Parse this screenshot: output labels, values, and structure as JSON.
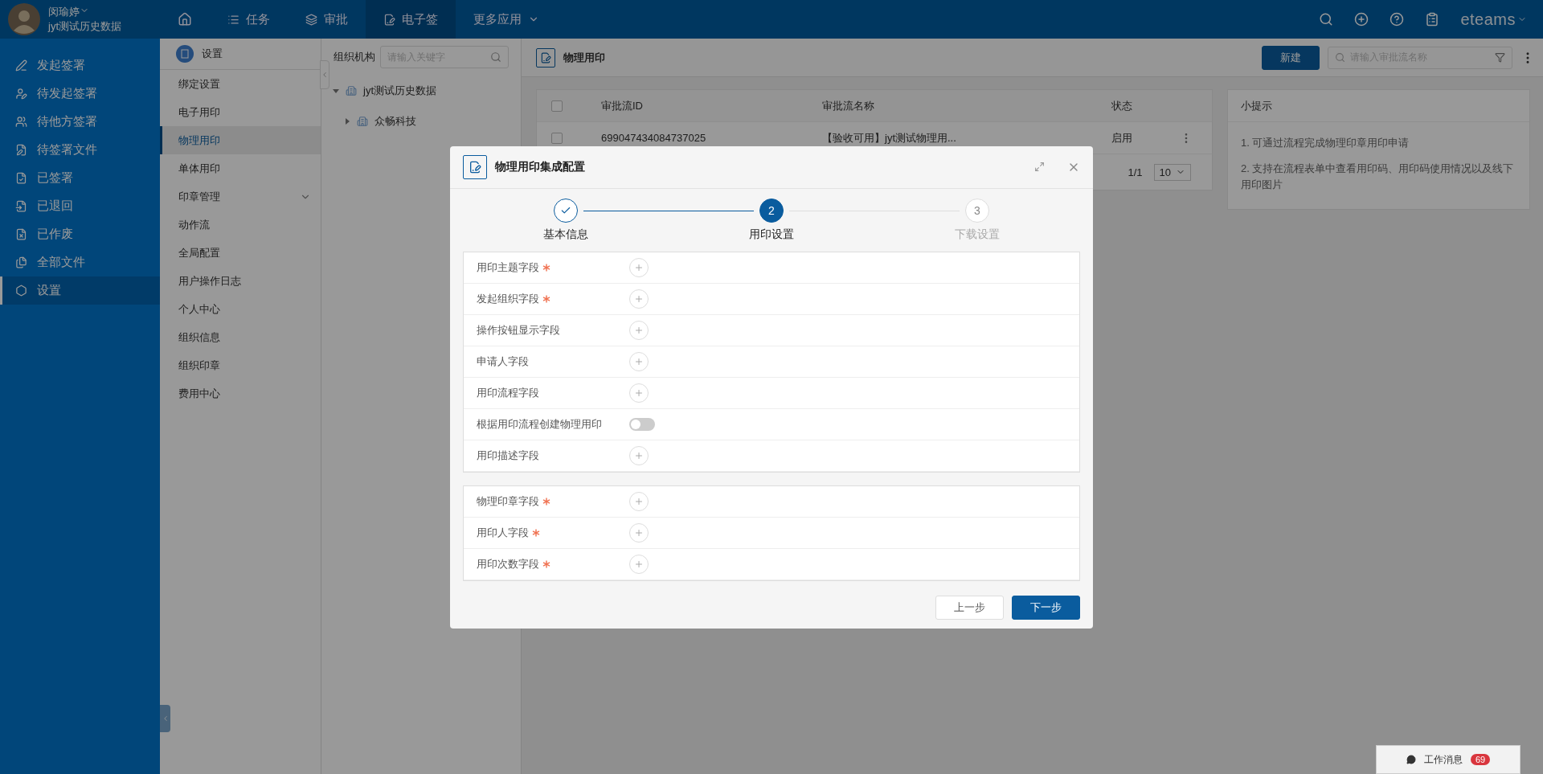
{
  "top_bar": {
    "user": {
      "name": "闵瑜婷",
      "org": "jyt测试历史数据"
    },
    "nav": [
      {
        "kind": "home",
        "selected": false
      },
      {
        "kind": "tab",
        "label": "任务",
        "selected": false
      },
      {
        "kind": "tab",
        "label": "审批",
        "selected": false
      },
      {
        "kind": "tab",
        "label": "电子签",
        "selected": true
      },
      {
        "kind": "dropdown",
        "label": "更多应用",
        "selected": false
      }
    ],
    "brand": "eteams"
  },
  "sidebar": {
    "items": [
      {
        "label": "发起签署",
        "selected": false
      },
      {
        "label": "待发起签署",
        "selected": false
      },
      {
        "label": "待他方签署",
        "selected": false
      },
      {
        "label": "待签署文件",
        "selected": false
      },
      {
        "label": "已签署",
        "selected": false
      },
      {
        "label": "已退回",
        "selected": false
      },
      {
        "label": "已作废",
        "selected": false
      },
      {
        "label": "全部文件",
        "selected": false
      },
      {
        "label": "设置",
        "selected": true
      }
    ]
  },
  "settings_menu": {
    "title": "设置",
    "items": [
      {
        "label": "绑定设置",
        "selected": false
      },
      {
        "label": "电子用印",
        "selected": false
      },
      {
        "label": "物理用印",
        "selected": true
      },
      {
        "label": "单体用印",
        "selected": false
      },
      {
        "label": "印章管理",
        "selected": false,
        "expanded": false
      },
      {
        "label": "动作流",
        "selected": false
      },
      {
        "label": "全局配置",
        "selected": false
      },
      {
        "label": "用户操作日志",
        "selected": false
      },
      {
        "label": "个人中心",
        "selected": false
      },
      {
        "label": "组织信息",
        "selected": false
      },
      {
        "label": "组织印章",
        "selected": false
      },
      {
        "label": "费用中心",
        "selected": false
      }
    ]
  },
  "org_panel": {
    "label": "组织机构",
    "search": {
      "placeholder": "请输入关键字"
    },
    "tree": [
      {
        "label": "jyt测试历史数据",
        "expanded": true,
        "children": [
          {
            "label": "众畅科技",
            "expanded": false
          }
        ]
      }
    ]
  },
  "main": {
    "title": "物理用印",
    "new_button": "新建",
    "search": {
      "placeholder": "请输入审批流名称"
    },
    "table": {
      "all_checked": false,
      "columns": [
        "审批流ID",
        "审批流名称",
        "状态"
      ],
      "rows": [
        {
          "checked": false,
          "cells": [
            "699047434084737025",
            "【验收可用】jyt测试物理用...",
            "启用"
          ]
        }
      ],
      "pagination": "1/1",
      "page_size": "10"
    },
    "tips": {
      "title": "小提示",
      "items": [
        "1. 可通过流程完成物理印章用印申请",
        "2. 支持在流程表单中查看用印码、用印码使用情况以及线下用印图片"
      ]
    }
  },
  "modal": {
    "title": "物理用印集成配置",
    "steps": [
      {
        "kind": "done",
        "label": "基本信息"
      },
      {
        "kind": "current",
        "number": "2",
        "label": "用印设置"
      },
      {
        "kind": "wait",
        "number": "3",
        "label": "下载设置"
      }
    ],
    "groups": [
      [
        {
          "kind": "add",
          "label": "用印主题字段",
          "required": true
        },
        {
          "kind": "add",
          "label": "发起组织字段",
          "required": true
        },
        {
          "kind": "add",
          "label": "操作按钮显示字段",
          "required": false
        },
        {
          "kind": "add",
          "label": "申请人字段",
          "required": false
        },
        {
          "kind": "add",
          "label": "用印流程字段",
          "required": false
        },
        {
          "kind": "toggle",
          "label": "根据用印流程创建物理用印",
          "required": false,
          "on": false
        },
        {
          "kind": "add",
          "label": "用印描述字段",
          "required": false
        }
      ],
      [
        {
          "kind": "add",
          "label": "物理印章字段",
          "required": true
        },
        {
          "kind": "add",
          "label": "用印人字段",
          "required": true
        },
        {
          "kind": "add",
          "label": "用印次数字段",
          "required": true
        }
      ]
    ],
    "buttons": {
      "prev": "上一步",
      "next": "下一步"
    }
  },
  "message_bar": {
    "label": "工作消息",
    "count": "69"
  }
}
